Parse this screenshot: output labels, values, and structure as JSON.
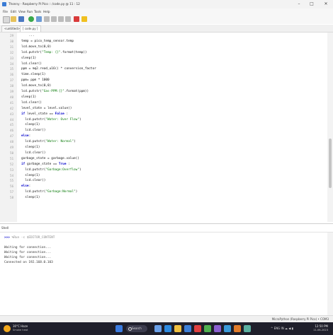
{
  "window": {
    "title": "Thonny  -  Raspberry Pi Pico :: /code.py  @  11 : 12",
    "controls": [
      "–",
      "□",
      "✕"
    ]
  },
  "menu": [
    "File",
    "Edit",
    "View",
    "Run",
    "Tools",
    "Help"
  ],
  "tabs": [
    "<untitled>",
    "[ code.py ]"
  ],
  "editor": {
    "line_numbers": [
      "29",
      "30",
      "31",
      "32",
      "33",
      "34",
      "35",
      "36",
      "37",
      "38",
      "39",
      "40",
      "41",
      "42",
      "43",
      "44",
      "45",
      "46",
      "47",
      "48",
      "49",
      "50",
      "51",
      "52",
      "53",
      "54",
      "55",
      "56",
      "57",
      "58",
      "59",
      "60",
      "61"
    ],
    "lines": [
      "    ...",
      "temp = pico_temp_sensor.temp",
      "lcd.move_to(0,0)",
      "lcd.putstr(\"Temp: {}\".format(temp))",
      "sleep(1)",
      "lcd.clear()",
      "ppm = mq2.read_u16() * conversion_factor",
      "time.sleep(1)",
      "ppm= ppm * 1000",
      "lcd.move_to(0,0)",
      "lcd.putstr(\"Gas-PPM:{}\".format(ppm))",
      "sleep(1)",
      "lcd.clear()",
      "level_state = level.value()",
      "if level_state == False :",
      "  lcd.putstr(\"Water: Over Flow\")",
      "  sleep(1)",
      "  lcd.clear()",
      "else:",
      "  lcd.putstr(\"Water: Normal\")",
      "  sleep(1)",
      "  lcd.clear()",
      "garbage_state = garbage.value()",
      "if garbage_state == True :",
      "  lcd.putstr(\"Garbage:Overflow\")",
      "  sleep(1)",
      "  lcd.clear()",
      "else:",
      "  lcd.putstr(\"Garbage:Normal\")",
      "  sleep(1)"
    ]
  },
  "shell": {
    "tab_label": "Shell",
    "prompt": ">>>",
    "command": "%Run -c $EDITOR_CONTENT",
    "output": [
      "Waiting for connection...",
      "Waiting for connection...",
      "Waiting for connection...",
      "Connected on 192.168.0.103"
    ]
  },
  "statusbar": {
    "text": "MicroPython (Raspberry Pi Pico)  •  COM3"
  },
  "taskbar": {
    "weather_temp": "30°C Haze",
    "weather_cond": "Smoke heat",
    "search_label": "Search",
    "tray": "^   ENG  IN   ☁ ◀ ▮",
    "time": "12:50 PM",
    "date": "11-06-2023"
  },
  "colors": {
    "keyword": "#0000cc",
    "string": "#0a7a0a",
    "taskbar": "#1f1f2b"
  }
}
